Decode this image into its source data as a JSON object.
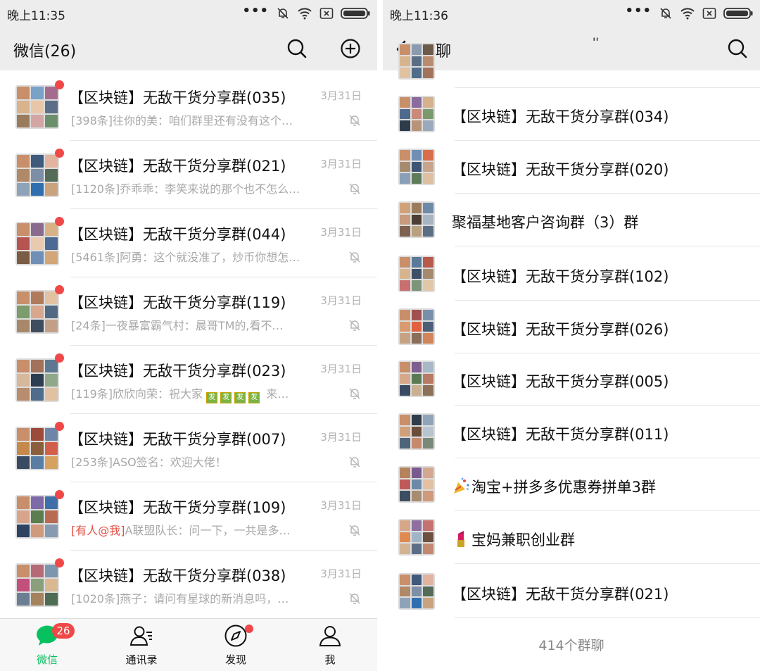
{
  "left": {
    "status_time": "晚上11:35",
    "status_dots": "•••",
    "title": "微信(26)",
    "chats": [
      {
        "name": "【区块链】无敌干货分享群(035)",
        "date": "3月31日",
        "preview": "[398条]往你的美：咱们群里还有没有这个…",
        "avatar": [
          "#c98f6a",
          "#7aa1c8",
          "#a56b8e",
          "#d9b38c",
          "#e8c7a8",
          "#5c6f88",
          "#9a7b5e",
          "#d4a5a5",
          "#6b8e6b"
        ]
      },
      {
        "name": "【区块链】无敌干货分享群(021)",
        "date": "3月31日",
        "preview": "[1120条]乔乖乖：李笑来说的那个也不怎么…",
        "avatar": [
          "#c98f6a",
          "#3f5a7a",
          "#e2b4a0",
          "#b08968",
          "#7d8fa6",
          "#546b57",
          "#8fa3b8",
          "#2f6fb0",
          "#c9a27e"
        ]
      },
      {
        "name": "【区块链】无敌干货分享群(044)",
        "date": "3月31日",
        "preview": "[5461条]阿勇：这个就没准了，炒币你想怎…",
        "avatar": [
          "#c98f6a",
          "#8a6b8e",
          "#d8b184",
          "#b85450",
          "#e9c9b0",
          "#4c6a92",
          "#7b5c44",
          "#6f8fb5",
          "#d2a679"
        ]
      },
      {
        "name": "【区块链】无敌干货分享群(119)",
        "date": "3月31日",
        "preview": "[24条]一夜暴富霸气村：晨哥TM的,看不…",
        "avatar": [
          "#c98f6a",
          "#b07a5c",
          "#e3c1a3",
          "#7c9c6e",
          "#d8a88e",
          "#516983",
          "#a8876b",
          "#3e4d5e",
          "#c4a089"
        ]
      },
      {
        "name": "【区块链】无敌干货分享群(023)",
        "date": "3月31日",
        "preview_parts": [
          "[119条]欣欣向荣：祝大家 ",
          "发",
          "发",
          "发",
          "发",
          " 来…"
        ],
        "avatar": [
          "#c98f6a",
          "#a3725a",
          "#5f7892",
          "#d8b89a",
          "#2c3e50",
          "#8fa88a",
          "#b88c6e",
          "#4f6d8a",
          "#e0c2a2"
        ]
      },
      {
        "name": "【区块链】无敌干货分享群(007)",
        "date": "3月31日",
        "preview": "[253条]ASO签名：欢迎大佬！",
        "avatar": [
          "#c98f6a",
          "#9c4a3a",
          "#6d86a8",
          "#c7884c",
          "#8b5e3c",
          "#d25f4a",
          "#394b63",
          "#5a7ea3",
          "#d6a15c"
        ]
      },
      {
        "name": "【区块链】无敌干货分享群(109)",
        "date": "3月31日",
        "mention": "[有人@我]",
        "preview": "A联盟队长：问一下，一共是多…",
        "avatar": [
          "#c98f6a",
          "#7e6aa8",
          "#3f6fa8",
          "#d9a58a",
          "#5c7d4f",
          "#b86b52",
          "#2f4260",
          "#cf9b7e",
          "#889ab0"
        ]
      },
      {
        "name": "【区块链】无敌干货分享群(038)",
        "date": "3月31日",
        "preview": "[1020条]燕子：请问有星球的新消息吗，…",
        "avatar": [
          "#c98f6a",
          "#b66a78",
          "#7d95ad",
          "#c3507a",
          "#8aa07a",
          "#d9b892",
          "#6a7f93",
          "#a5835f",
          "#4e6c54"
        ]
      }
    ],
    "tabs": [
      {
        "label": "微信",
        "badge": "26"
      },
      {
        "label": "通讯录"
      },
      {
        "label": "发现"
      },
      {
        "label": "我"
      }
    ]
  },
  "right": {
    "status_time": "晚上11:36",
    "status_dots": "•••",
    "title": "群聊",
    "partial_name": "''",
    "groups": [
      {
        "name": "【区块链】无敌干货分享群(034)",
        "avatar": [
          "#c98f6a",
          "#8b6b9e",
          "#d7b08c",
          "#4f6a8c",
          "#c98a7a",
          "#7a9a6e",
          "#2e3b4a",
          "#b8937a",
          "#9aa9bb"
        ]
      },
      {
        "name": "【区块链】无敌干货分享群(020)",
        "avatar": [
          "#c98f6a",
          "#6f8fb5",
          "#d96f4a",
          "#a58b6e",
          "#3d5573",
          "#c7a48a",
          "#8aa0b8",
          "#5e7c5a",
          "#dcc0a0"
        ]
      },
      {
        "name": "聚福基地客户咨询群（3）群",
        "avatar": [
          "#d1a27a",
          "#9a7c5c",
          "#6d8aa8",
          "#c89a7e",
          "#4a3e36",
          "#a7b4c2",
          "#7d6250",
          "#b9a080",
          "#5a6e84"
        ]
      },
      {
        "name": "【区块链】无敌干货分享群(102)",
        "avatar": [
          "#c98f6a",
          "#5a7a9a",
          "#b85a4a",
          "#d8b48e",
          "#3e5066",
          "#a68a6e",
          "#c96f6f",
          "#7d9478",
          "#e1c7a6"
        ]
      },
      {
        "name": "【区块链】无敌干货分享群(026)",
        "avatar": [
          "#c98f6a",
          "#a05050",
          "#7890aa",
          "#d89a6e",
          "#e06040",
          "#4c5e78",
          "#c5a284",
          "#8a6e58",
          "#d3855a"
        ]
      },
      {
        "name": "【区块链】无敌干货分享群(005)",
        "avatar": [
          "#c98f6a",
          "#7e5f8f",
          "#a7b8c8",
          "#d6a88a",
          "#5a7a52",
          "#b77a62",
          "#394b63",
          "#c9b090",
          "#8c7058"
        ]
      },
      {
        "name": "【区块链】无敌干货分享群(011)",
        "avatar": [
          "#c98f6a",
          "#2f3c4c",
          "#8fa4b8",
          "#d0a07c",
          "#6a4e3c",
          "#b8c4d0",
          "#4e6478",
          "#c58a6e",
          "#7a8a7a"
        ]
      },
      {
        "name": "淘宝+拼多多优惠券拼单3群",
        "icon": "party-popper",
        "avatar": [
          "#b5835e",
          "#7a5a8e",
          "#d4a890",
          "#c05a5a",
          "#6c8aa8",
          "#e2c0a0",
          "#3e4e62",
          "#a88c70",
          "#d09a7a"
        ]
      },
      {
        "name": "宝妈兼职创业群",
        "icon": "lipstick",
        "avatar": [
          "#d7a78a",
          "#8e6fa0",
          "#c77070",
          "#e08a50",
          "#a0b4c6",
          "#6e5040",
          "#d2b494",
          "#5a6e86",
          "#c28870"
        ]
      },
      {
        "name": "【区块链】无敌干货分享群(021)",
        "avatar": [
          "#c98f6a",
          "#3f5a7a",
          "#e2b4a0",
          "#b08968",
          "#7d8fa6",
          "#546b57",
          "#8fa3b8",
          "#2f6fb0",
          "#c9a27e"
        ]
      }
    ],
    "group_count": "414个群聊"
  },
  "colors": {
    "accent_green": "#07c160",
    "badge_red": "#f04848",
    "mention_red": "#e54d42",
    "header_bg": "#ededed"
  }
}
